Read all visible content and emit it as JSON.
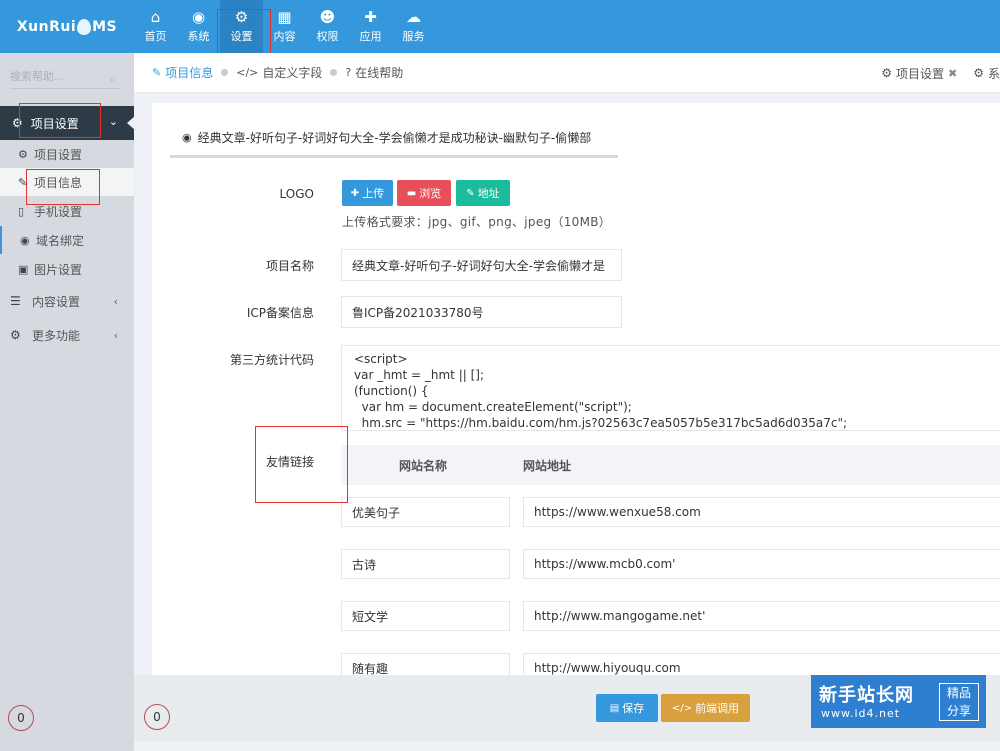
{
  "app": {
    "logo_text_left": "XunRui",
    "logo_text_right": "MS"
  },
  "topnav": [
    {
      "icon": "home-icon",
      "glyph": "⌂",
      "label": "首页"
    },
    {
      "icon": "globe-icon",
      "glyph": "◉",
      "label": "系统"
    },
    {
      "icon": "gears-icon",
      "glyph": "⚙",
      "label": "设置"
    },
    {
      "icon": "grid-icon",
      "glyph": "▦",
      "label": "内容"
    },
    {
      "icon": "user-icon",
      "glyph": "☻",
      "label": "权限"
    },
    {
      "icon": "puzzle-icon",
      "glyph": "✚",
      "label": "应用"
    },
    {
      "icon": "cloud-icon",
      "glyph": "☁",
      "label": "服务"
    }
  ],
  "sidebar": {
    "search_placeholder": "搜索帮助...",
    "head_label": "项目设置",
    "items": [
      {
        "icon": "gear-icon",
        "glyph": "⚙",
        "label": "项目设置"
      },
      {
        "icon": "edit-icon",
        "glyph": "✎",
        "label": "项目信息"
      },
      {
        "icon": "mobile-icon",
        "glyph": "▯",
        "label": "手机设置"
      },
      {
        "icon": "globe-icon",
        "glyph": "◉",
        "label": "域名绑定"
      },
      {
        "icon": "image-icon",
        "glyph": "▣",
        "label": "图片设置"
      }
    ],
    "groups": [
      {
        "icon": "list-icon",
        "glyph": "☰",
        "label": "内容设置"
      },
      {
        "icon": "gears-icon",
        "glyph": "⚙",
        "label": "更多功能"
      }
    ],
    "badge_left": "0",
    "badge_right": "0"
  },
  "crumbs": [
    {
      "icon": "edit-icon",
      "glyph": "✎",
      "label": "项目信息"
    },
    {
      "icon": "code-icon",
      "glyph": "</>",
      "label": "自定义字段"
    },
    {
      "icon": "question-icon",
      "glyph": "?",
      "label": "在线帮助"
    }
  ],
  "right_tabs": [
    {
      "label": "项目设置",
      "close": "✖"
    },
    {
      "label": "系"
    }
  ],
  "panel": {
    "title": "经典文章-好听句子-好词好句大全-学会偷懒才是成功秘诀-幽默句子-偷懒部",
    "logo_label": "LOGO",
    "upload_btn": "上传",
    "browse_btn": "浏览",
    "address_btn": "地址",
    "upload_hint": "上传格式要求：jpg、gif、png、jpeg（10MB）",
    "name_label": "项目名称",
    "name_value": "经典文章-好听句子-好词好句大全-学会偷懒才是",
    "icp_label": "ICP备案信息",
    "icp_value": "鲁ICP备2021033780号",
    "stats_label": "第三方统计代码",
    "stats_code": "<script>\nvar _hmt = _hmt || [];\n(function() {\n  var hm = document.createElement(\"script\");\n  hm.src = \"https://hm.baidu.com/hm.js?02563c7ea5057b5e317bc5ad6d035a7c\";",
    "links_label": "友情链接",
    "links_col_name": "网站名称",
    "links_col_url": "网站地址",
    "links": [
      {
        "name": "优美句子",
        "url": "https://www.wenxue58.com"
      },
      {
        "name": "古诗",
        "url": "https://www.mcb0.com'"
      },
      {
        "name": "短文学",
        "url": "http://www.mangogame.net'"
      },
      {
        "name": "随有趣",
        "url": "http://www.hiyouqu.com"
      }
    ]
  },
  "footer": {
    "save_btn": "保存",
    "frontend_btn": "前端调用"
  },
  "watermark": {
    "title": "新手站长网",
    "url": "www.ld4.net",
    "tag_top": "精品",
    "tag_bottom": "分享"
  },
  "colors": {
    "topbar": "#3598dc",
    "upload": "#3598dc",
    "browse": "#e7505a",
    "address": "#1bbc9b",
    "save": "#3598dc",
    "frontend": "#d9a03f",
    "watermark": "#2f7fd1"
  }
}
